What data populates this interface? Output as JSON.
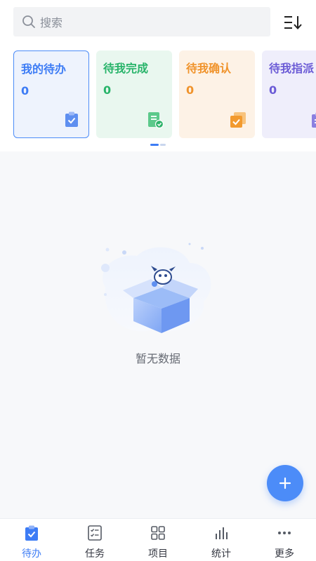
{
  "search": {
    "placeholder": "搜索",
    "icon": "search-icon"
  },
  "toolbar": {
    "sort_icon": "sort-icon"
  },
  "cards": [
    {
      "title": "我的待办",
      "count": "0",
      "color": "#3d7cf5",
      "bg": "#eef3fd",
      "border": "#4c8cf8",
      "icon": "clipboard-check-icon"
    },
    {
      "title": "待我完成",
      "count": "0",
      "color": "#28b46a",
      "bg": "#e9f7ef",
      "icon": "document-check-icon"
    },
    {
      "title": "待我确认",
      "count": "0",
      "color": "#f0932b",
      "bg": "#fdf2e6",
      "icon": "stack-check-icon"
    },
    {
      "title": "待我指派",
      "count": "0",
      "color": "#6b5bd6",
      "bg": "#efeefb",
      "icon": "assign-icon"
    }
  ],
  "empty": {
    "text": "暂无数据",
    "icon": "empty-box-icon"
  },
  "fab": {
    "icon": "plus-icon"
  },
  "tabs": [
    {
      "label": "待办",
      "icon": "todo-icon",
      "active": true
    },
    {
      "label": "任务",
      "icon": "task-list-icon"
    },
    {
      "label": "项目",
      "icon": "grid-icon"
    },
    {
      "label": "统计",
      "icon": "stats-icon"
    },
    {
      "label": "更多",
      "icon": "more-icon"
    }
  ],
  "colors": {
    "accent": "#3d7cf5",
    "fab": "#4c8cf8"
  }
}
